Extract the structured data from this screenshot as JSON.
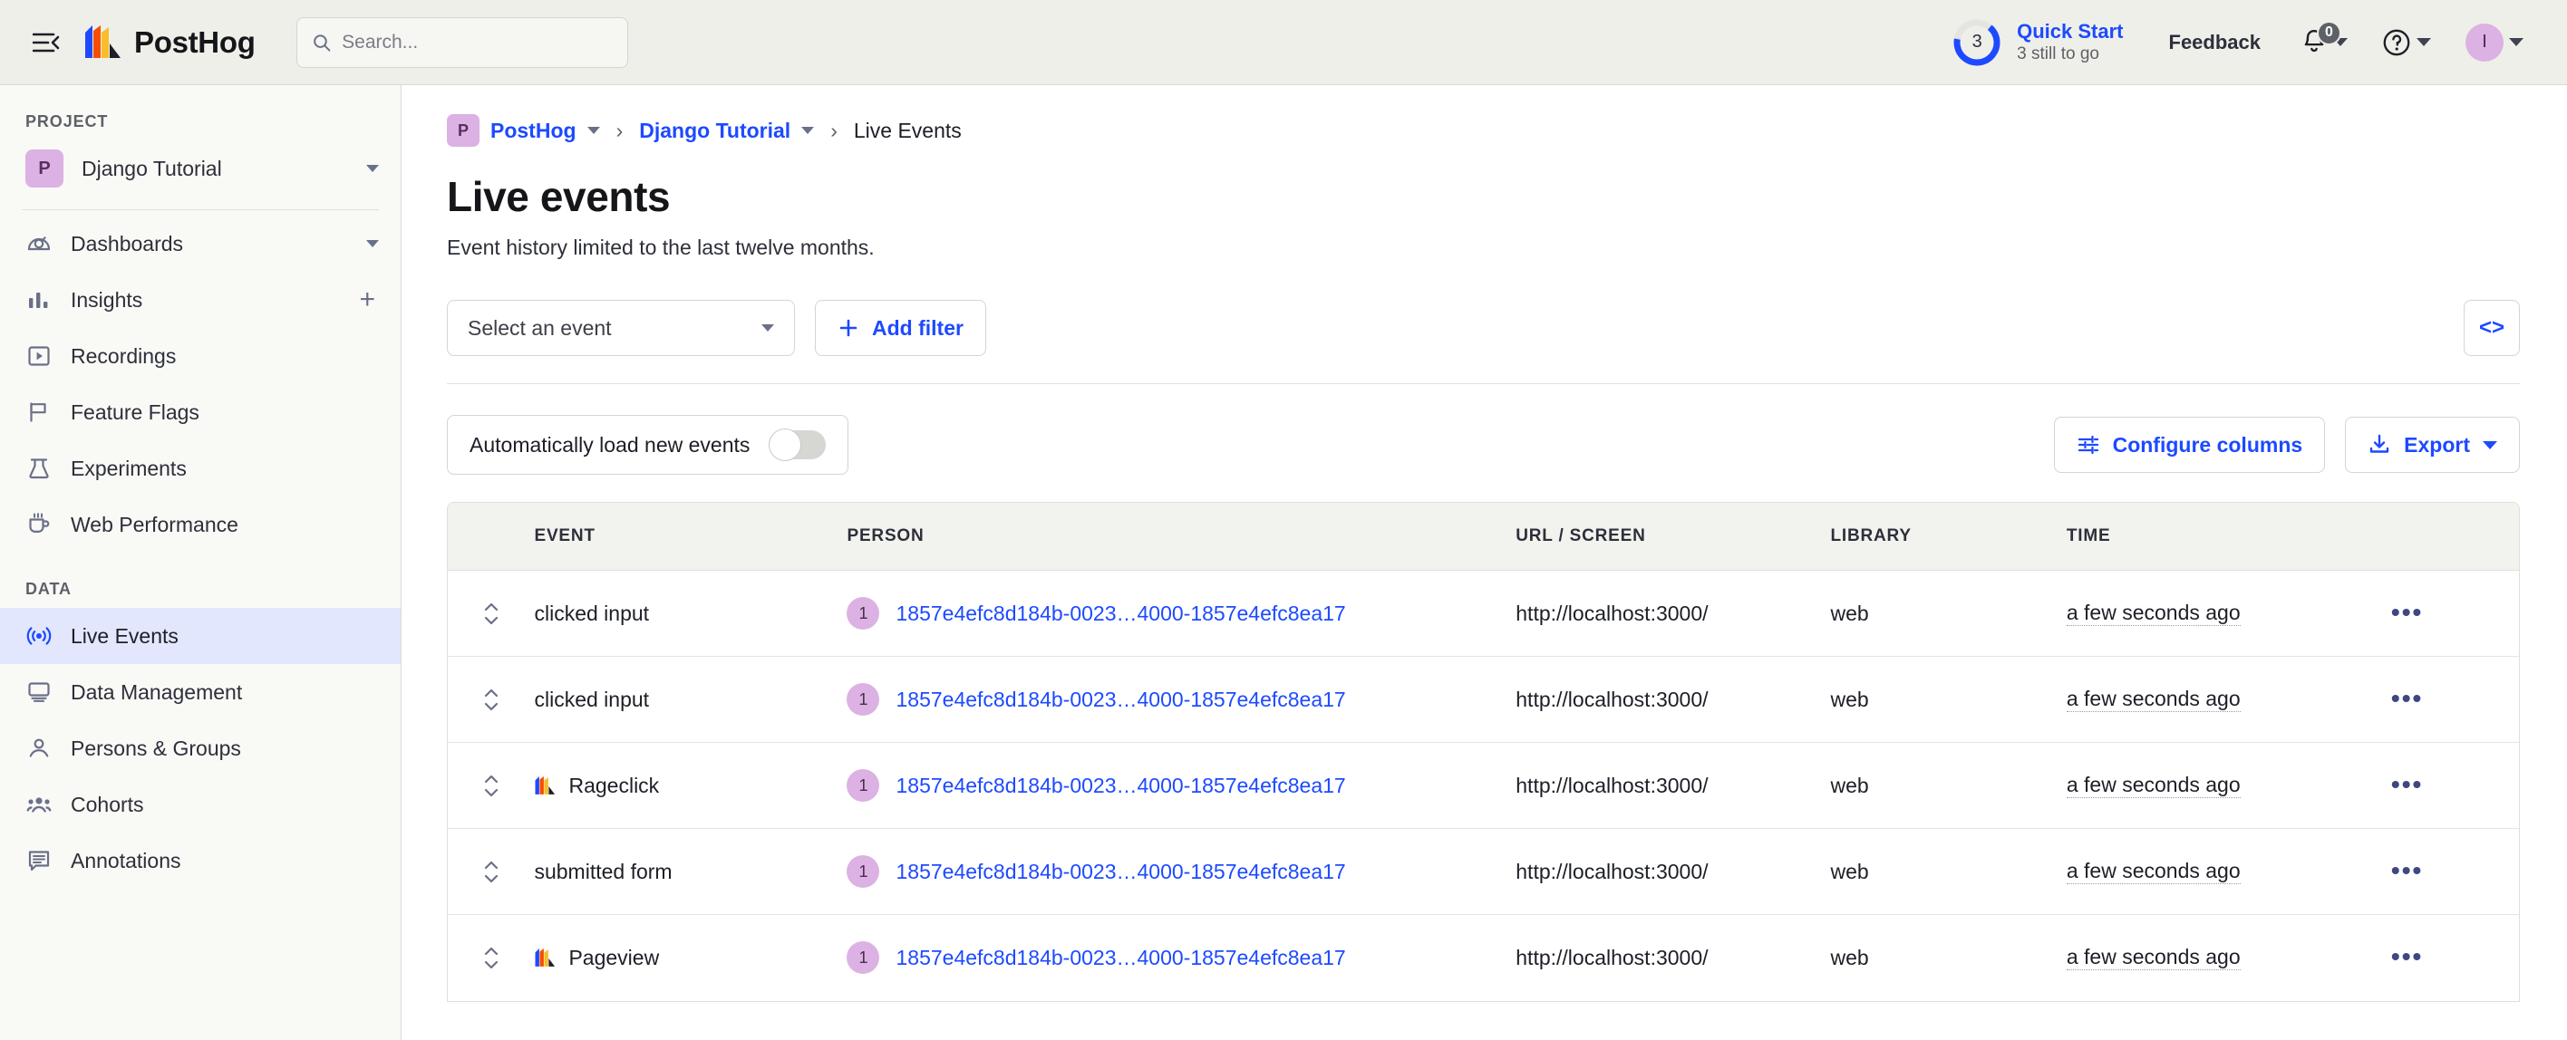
{
  "topbar": {
    "menu_icon": "hamburger-collapse-icon",
    "brand": "PostHog",
    "search_placeholder": "Search...",
    "search_value": "",
    "quick_start": {
      "count": "3",
      "title": "Quick Start",
      "subtitle": "3 still to go",
      "progress_percent": 66
    },
    "feedback_label": "Feedback",
    "notifications_badge": "0",
    "avatar_initial": "I"
  },
  "sidebar": {
    "project_section_label": "PROJECT",
    "project": {
      "badge": "P",
      "name": "Django Tutorial"
    },
    "data_section_label": "DATA",
    "items": [
      {
        "label": "Dashboards",
        "icon": "dashboard-gauge-icon",
        "trailing": "chevron-down",
        "active": false
      },
      {
        "label": "Insights",
        "icon": "bar-chart-icon",
        "trailing": "plus",
        "active": false
      },
      {
        "label": "Recordings",
        "icon": "play-square-icon",
        "trailing": "",
        "active": false
      },
      {
        "label": "Feature Flags",
        "icon": "flag-icon",
        "trailing": "",
        "active": false
      },
      {
        "label": "Experiments",
        "icon": "flask-icon",
        "trailing": "",
        "active": false
      },
      {
        "label": "Web Performance",
        "icon": "coffee-cup-icon",
        "trailing": "",
        "active": false
      }
    ],
    "data_items": [
      {
        "label": "Live Events",
        "icon": "broadcast-icon",
        "active": true
      },
      {
        "label": "Data Management",
        "icon": "monitor-icon",
        "active": false
      },
      {
        "label": "Persons & Groups",
        "icon": "person-icon",
        "active": false
      },
      {
        "label": "Cohorts",
        "icon": "people-group-icon",
        "active": false
      },
      {
        "label": "Annotations",
        "icon": "comment-lines-icon",
        "active": false
      }
    ]
  },
  "breadcrumb": {
    "org_badge": "P",
    "org": "PostHog",
    "project": "Django Tutorial",
    "current": "Live Events",
    "separator": "›"
  },
  "page": {
    "title": "Live events",
    "description": "Event history limited to the last twelve months."
  },
  "filters": {
    "event_select_label": "Select an event",
    "add_filter_label": "Add filter",
    "code_button_label": "<>"
  },
  "toolbar": {
    "autoload_label": "Automatically load new events",
    "autoload_on": false,
    "configure_columns_label": "Configure columns",
    "export_label": "Export"
  },
  "table": {
    "columns": [
      "",
      "EVENT",
      "PERSON",
      "URL / SCREEN",
      "LIBRARY",
      "TIME",
      ""
    ],
    "rows": [
      {
        "event": "clicked input",
        "event_icon": "",
        "person_count": "1",
        "person": "1857e4efc8d184b-0023…4000-1857e4efc8ea17",
        "url": "http://localhost:3000/",
        "library": "web",
        "time": "a few seconds ago"
      },
      {
        "event": "clicked input",
        "event_icon": "",
        "person_count": "1",
        "person": "1857e4efc8d184b-0023…4000-1857e4efc8ea17",
        "url": "http://localhost:3000/",
        "library": "web",
        "time": "a few seconds ago"
      },
      {
        "event": "Rageclick",
        "event_icon": "posthog-hog-icon",
        "person_count": "1",
        "person": "1857e4efc8d184b-0023…4000-1857e4efc8ea17",
        "url": "http://localhost:3000/",
        "library": "web",
        "time": "a few seconds ago"
      },
      {
        "event": "submitted form",
        "event_icon": "",
        "person_count": "1",
        "person": "1857e4efc8d184b-0023…4000-1857e4efc8ea17",
        "url": "http://localhost:3000/",
        "library": "web",
        "time": "a few seconds ago"
      },
      {
        "event": "Pageview",
        "event_icon": "posthog-hog-icon",
        "person_count": "1",
        "person": "1857e4efc8d184b-0023…4000-1857e4efc8ea17",
        "url": "http://localhost:3000/",
        "library": "web",
        "time": "a few seconds ago"
      }
    ]
  },
  "colors": {
    "accent_blue": "#1d4aff",
    "chrome_bg": "#EEEFE9",
    "sidebar_bg": "#F9F9F6",
    "active_item_bg": "#E3E7FD",
    "badge_purple": "#DCB1E3",
    "table_header_bg": "#F2F2EE"
  }
}
